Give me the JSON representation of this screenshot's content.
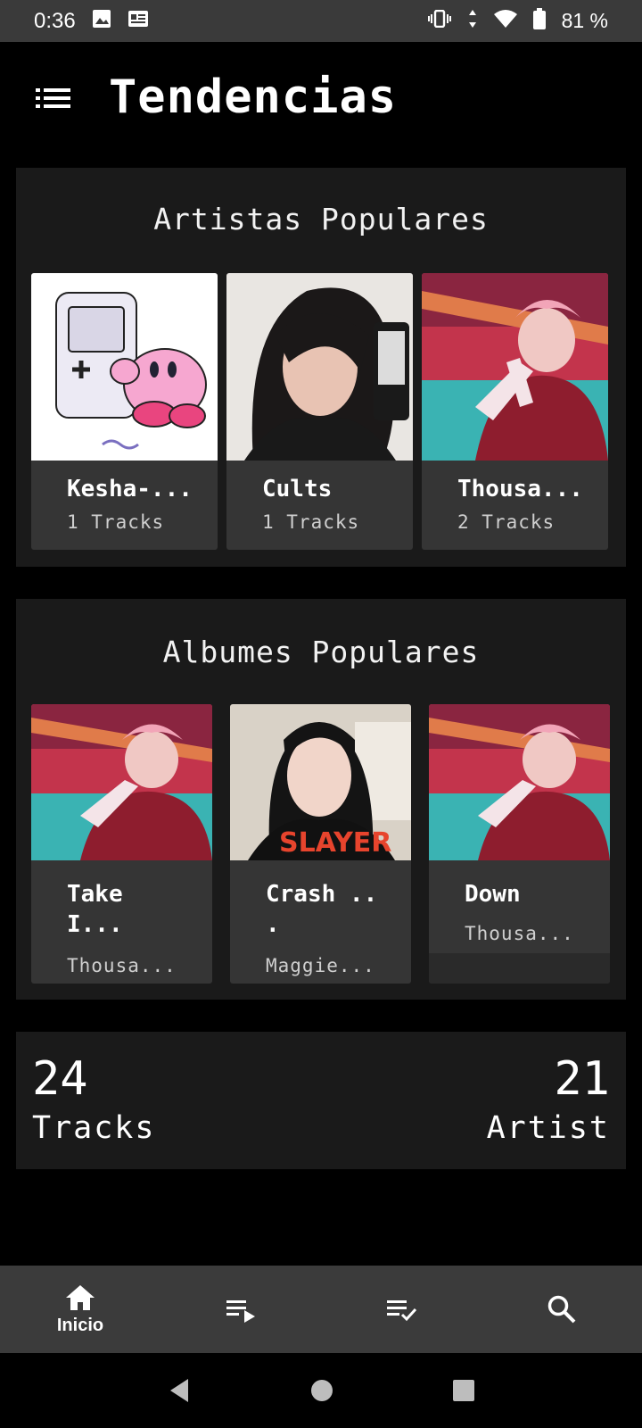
{
  "status_bar": {
    "time": "0:36",
    "battery": "81 %",
    "icons": [
      "image-icon",
      "news-icon",
      "vibrate-icon",
      "data-icon",
      "wifi-icon",
      "battery-icon"
    ]
  },
  "header": {
    "title": "Tendencias",
    "menu_icon": "list-menu-icon"
  },
  "artists_section": {
    "title": "Artistas Populares",
    "items": [
      {
        "name": "Kesha-...",
        "tracks": "1 Tracks",
        "image": "kirby-gameboy-art"
      },
      {
        "name": "Cults",
        "tracks": "1 Tracks",
        "image": "mirror-selfie-photo"
      },
      {
        "name": "Thousa...",
        "tracks": "2 Tracks",
        "image": "anime-character-art"
      }
    ]
  },
  "albums_section": {
    "title": "Albumes Populares",
    "items": [
      {
        "name": "Take\nI...",
        "artist": "Thousa...",
        "image": "anime-character-art"
      },
      {
        "name": "Crash ..\n.",
        "artist": "Maggie...",
        "image": "portrait-photo"
      },
      {
        "name": "Down",
        "artist": "Thousa...",
        "image": "anime-character-art"
      }
    ]
  },
  "stats": {
    "tracks_count": "24",
    "tracks_label": "Tracks",
    "artists_count": "21",
    "artists_label": "Artist"
  },
  "bottom_nav": {
    "items": [
      {
        "label": "Inicio",
        "icon": "home-icon",
        "active": true
      },
      {
        "label": "",
        "icon": "playlist-play-icon",
        "active": false
      },
      {
        "label": "",
        "icon": "playlist-check-icon",
        "active": false
      },
      {
        "label": "",
        "icon": "search-icon",
        "active": false
      }
    ]
  },
  "colors": {
    "background": "#000000",
    "panel": "#1a1a1a",
    "card": "#353535",
    "status_bar": "#3a3a3a",
    "bottom_nav": "#3b3b3b"
  }
}
